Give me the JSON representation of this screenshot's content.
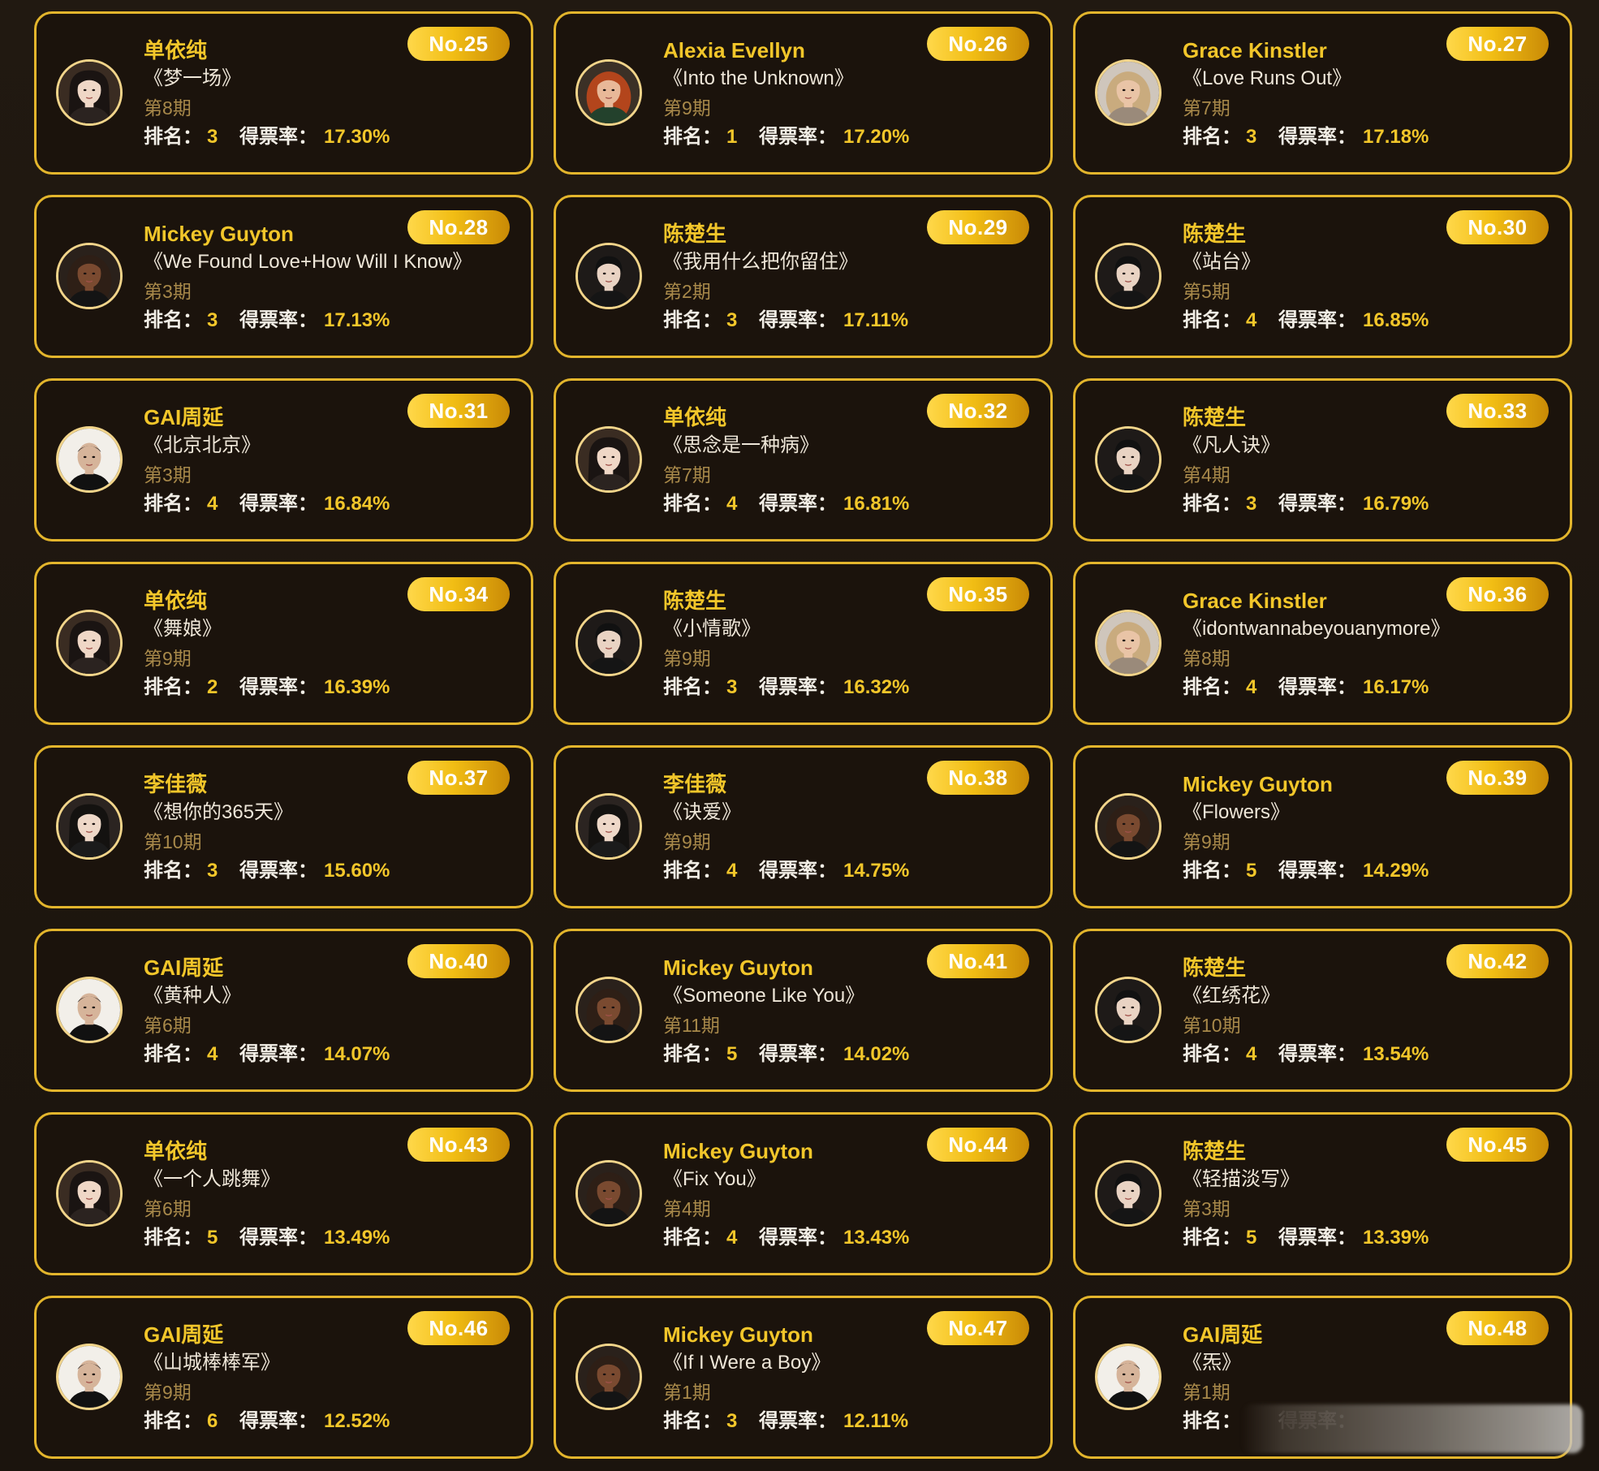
{
  "cards": [
    {
      "no": "No.25",
      "name": "单依纯",
      "song": "《梦一场》",
      "period": "第8期",
      "rank": "3",
      "rate": "17.30%",
      "avatar": "long-dark-hair-woman-avatar"
    },
    {
      "no": "No.26",
      "name": "Alexia Evellyn",
      "song": "《Into the Unknown》",
      "period": "第9期",
      "rank": "1",
      "rate": "17.20%",
      "avatar": "red-curly-hair-woman-avatar"
    },
    {
      "no": "No.27",
      "name": "Grace Kinstler",
      "song": "《Love Runs Out》",
      "period": "第7期",
      "rank": "3",
      "rate": "17.18%",
      "avatar": "blonde-wavy-hair-woman-avatar"
    },
    {
      "no": "No.28",
      "name": "Mickey Guyton",
      "song": "《We Found Love+How Will I Know》",
      "period": "第3期",
      "rank": "3",
      "rate": "17.13%",
      "avatar": "dark-curly-hair-woman-avatar"
    },
    {
      "no": "No.29",
      "name": "陈楚生",
      "song": "《我用什么把你留住》",
      "period": "第2期",
      "rank": "3",
      "rate": "17.11%",
      "avatar": "short-dark-hair-man-avatar"
    },
    {
      "no": "No.30",
      "name": "陈楚生",
      "song": "《站台》",
      "period": "第5期",
      "rank": "4",
      "rate": "16.85%",
      "avatar": "short-dark-hair-man-avatar"
    },
    {
      "no": "No.31",
      "name": "GAI周延",
      "song": "《北京北京》",
      "period": "第3期",
      "rank": "4",
      "rate": "16.84%",
      "avatar": "shaved-head-man-avatar"
    },
    {
      "no": "No.32",
      "name": "单依纯",
      "song": "《思念是一种病》",
      "period": "第7期",
      "rank": "4",
      "rate": "16.81%",
      "avatar": "long-dark-hair-woman-avatar"
    },
    {
      "no": "No.33",
      "name": "陈楚生",
      "song": "《凡人诀》",
      "period": "第4期",
      "rank": "3",
      "rate": "16.79%",
      "avatar": "short-dark-hair-man-avatar"
    },
    {
      "no": "No.34",
      "name": "单依纯",
      "song": "《舞娘》",
      "period": "第9期",
      "rank": "2",
      "rate": "16.39%",
      "avatar": "long-dark-hair-woman-avatar"
    },
    {
      "no": "No.35",
      "name": "陈楚生",
      "song": "《小情歌》",
      "period": "第9期",
      "rank": "3",
      "rate": "16.32%",
      "avatar": "short-dark-hair-man-avatar"
    },
    {
      "no": "No.36",
      "name": "Grace Kinstler",
      "song": "《idontwannabeyouanymore》",
      "period": "第8期",
      "rank": "4",
      "rate": "16.17%",
      "avatar": "blonde-wavy-hair-woman-avatar"
    },
    {
      "no": "No.37",
      "name": "李佳薇",
      "song": "《想你的365天》",
      "period": "第10期",
      "rank": "3",
      "rate": "15.60%",
      "avatar": "dark-hair-woman-avatar"
    },
    {
      "no": "No.38",
      "name": "李佳薇",
      "song": "《诀爱》",
      "period": "第9期",
      "rank": "4",
      "rate": "14.75%",
      "avatar": "dark-hair-woman-avatar"
    },
    {
      "no": "No.39",
      "name": "Mickey Guyton",
      "song": "《Flowers》",
      "period": "第9期",
      "rank": "5",
      "rate": "14.29%",
      "avatar": "dark-curly-hair-woman-avatar"
    },
    {
      "no": "No.40",
      "name": "GAI周延",
      "song": "《黄种人》",
      "period": "第6期",
      "rank": "4",
      "rate": "14.07%",
      "avatar": "shaved-head-man-avatar"
    },
    {
      "no": "No.41",
      "name": "Mickey Guyton",
      "song": "《Someone Like You》",
      "period": "第11期",
      "rank": "5",
      "rate": "14.02%",
      "avatar": "dark-curly-hair-woman-avatar"
    },
    {
      "no": "No.42",
      "name": "陈楚生",
      "song": "《红绣花》",
      "period": "第10期",
      "rank": "4",
      "rate": "13.54%",
      "avatar": "short-dark-hair-man-avatar"
    },
    {
      "no": "No.43",
      "name": "单依纯",
      "song": "《一个人跳舞》",
      "period": "第6期",
      "rank": "5",
      "rate": "13.49%",
      "avatar": "long-dark-hair-woman-avatar"
    },
    {
      "no": "No.44",
      "name": "Mickey Guyton",
      "song": "《Fix You》",
      "period": "第4期",
      "rank": "4",
      "rate": "13.43%",
      "avatar": "dark-curly-hair-woman-avatar"
    },
    {
      "no": "No.45",
      "name": "陈楚生",
      "song": "《轻描淡写》",
      "period": "第3期",
      "rank": "5",
      "rate": "13.39%",
      "avatar": "short-dark-hair-man-avatar"
    },
    {
      "no": "No.46",
      "name": "GAI周延",
      "song": "《山城棒棒军》",
      "period": "第9期",
      "rank": "6",
      "rate": "12.52%",
      "avatar": "shaved-head-man-avatar"
    },
    {
      "no": "No.47",
      "name": "Mickey Guyton",
      "song": "《If I Were a Boy》",
      "period": "第1期",
      "rank": "3",
      "rate": "12.11%",
      "avatar": "dark-curly-hair-woman-avatar"
    },
    {
      "no": "No.48",
      "name": "GAI周延",
      "song": "《炁》",
      "period": "第1期",
      "rank": "",
      "rate": "",
      "avatar": "shaved-head-man-avatar",
      "obscured": true
    }
  ],
  "labels": {
    "rank": "排名：",
    "rate": "得票率："
  },
  "colors": {
    "accent_gold": "#f2c62a",
    "card_border": "#e3b52c",
    "card_bg": "#1b130c",
    "badge_start": "#ffd84a",
    "badge_end": "#c98a06",
    "period_text": "#a8894a"
  }
}
